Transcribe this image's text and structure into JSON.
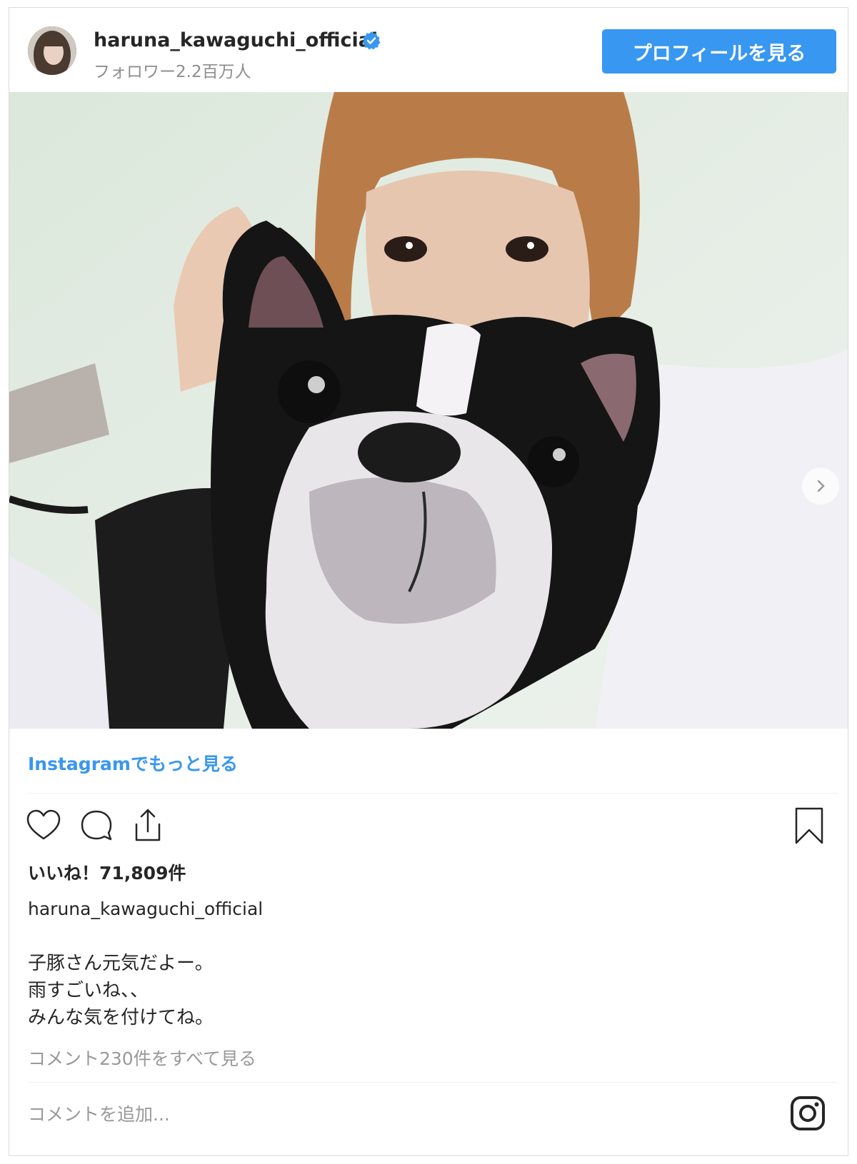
{
  "header": {
    "username": "haruna_kawaguchi_official",
    "followers": "フォロワー2.2百万人",
    "profile_button": "プロフィールを見る",
    "verified_icon": "verified-badge-icon",
    "accent": "#3897f0"
  },
  "post": {
    "more_link": "Instagramでもっと見る",
    "likes": "いいね！71,809件",
    "caption_user": "haruna_kawaguchi_official",
    "caption_lines": [
      "子豚さん元気だよー。",
      "雨すごいね、、",
      "みんな気を付けてね。"
    ],
    "view_comments": "コメント230件をすべて見る",
    "comment_placeholder": "コメントを追加...",
    "icons": [
      "heart-icon",
      "comment-icon",
      "share-icon",
      "bookmark-icon",
      "instagram-logo-icon",
      "next-arrow-icon"
    ]
  }
}
